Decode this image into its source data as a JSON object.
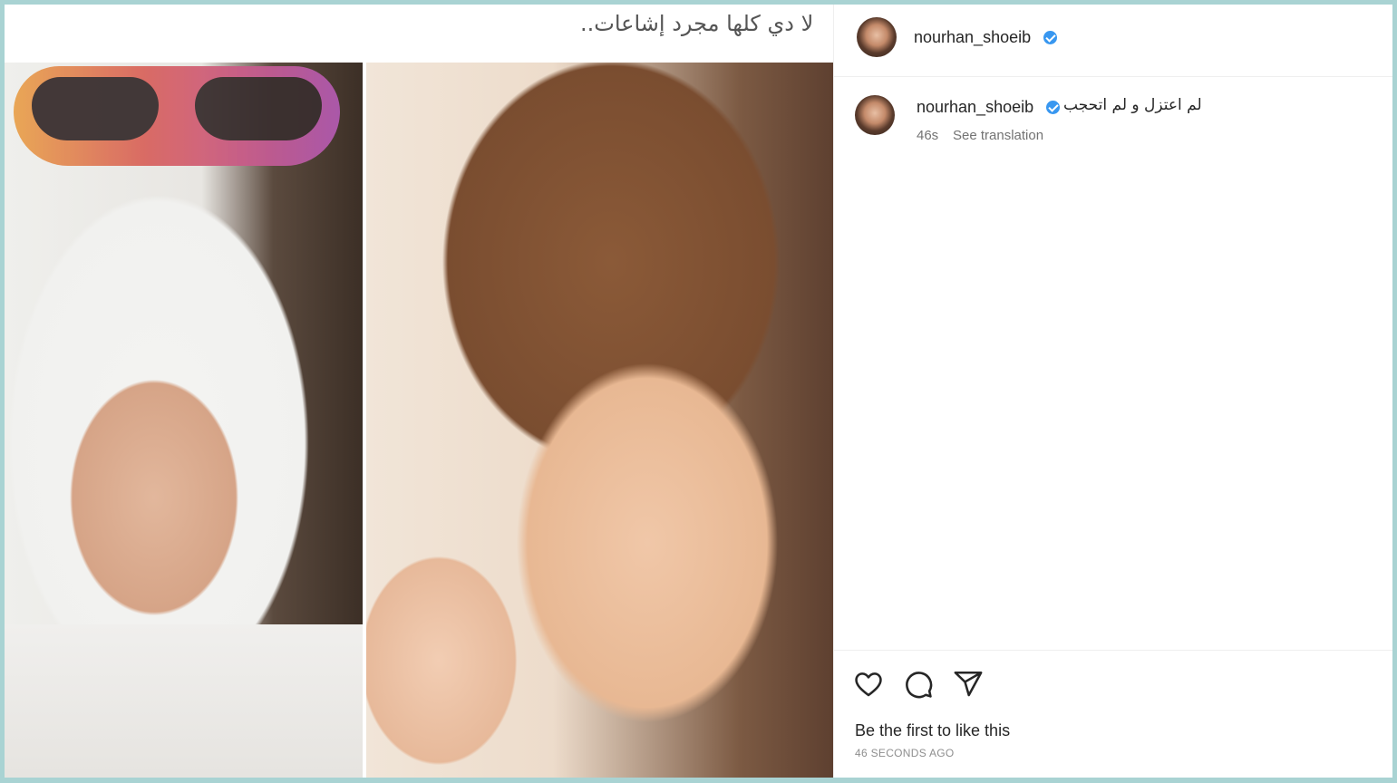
{
  "media": {
    "overlay_caption": "لا دي كلها مجرد إشاعات.."
  },
  "post": {
    "username": "nourhan_shoeib",
    "verified": true
  },
  "comment": {
    "username": "nourhan_shoeib",
    "text": "لم اعتزل و لم اتحجب",
    "time": "46s",
    "see_translation": "See translation"
  },
  "actions": {
    "like_icon": "heart-icon",
    "comment_icon": "comment-icon",
    "share_icon": "share-icon"
  },
  "likes_text": "Be the first to like this",
  "time_ago": "46 SECONDS AGO",
  "colors": {
    "frame_border": "#a9d3d3",
    "verified_badge": "#3897f0",
    "text_primary": "#262626",
    "text_secondary": "#737373"
  }
}
